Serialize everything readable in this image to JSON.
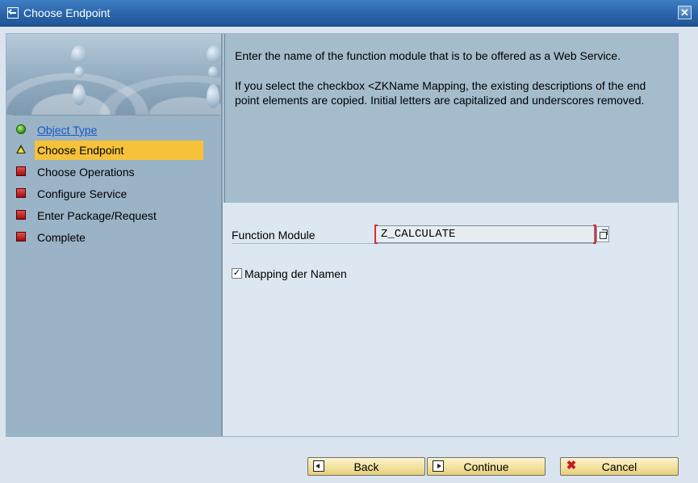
{
  "window": {
    "title": "Choose Endpoint",
    "close_glyph": "✕",
    "title_icon": "exit-icon"
  },
  "steps": [
    {
      "label": "Object Type",
      "status": "done",
      "icon": "green-light-icon"
    },
    {
      "label": "Choose Endpoint",
      "status": "current",
      "icon": "yellow-warning-icon"
    },
    {
      "label": "Choose Operations",
      "status": "pending",
      "icon": "red-square-icon"
    },
    {
      "label": "Configure Service",
      "status": "pending",
      "icon": "red-square-icon"
    },
    {
      "label": "Enter Package/Request",
      "status": "pending",
      "icon": "red-square-icon"
    },
    {
      "label": "Complete",
      "status": "pending",
      "icon": "red-square-icon"
    }
  ],
  "info": {
    "paragraph1": "Enter the name of the function module that is to be offered as a Web Service.",
    "paragraph2": "If you select the checkbox <ZKName Mapping, the existing descriptions of the end point elements are copied. Initial letters are capitalized and underscores removed."
  },
  "form": {
    "function_module_label": "Function Module",
    "function_module_value": "Z_CALCULATE",
    "mapping_checkbox_label": "Mapping der Namen",
    "mapping_checked": true,
    "check_glyph": "✓"
  },
  "buttons": {
    "back": "Back",
    "continue": "Continue",
    "cancel": "Cancel",
    "cancel_glyph": "✖"
  },
  "colors": {
    "title_bar": "#2a64a8",
    "active_step": "#f6c23a",
    "info_panel": "#a5bccd",
    "nav_panel": "#9ab3c6",
    "button": "#f2e2a0"
  }
}
